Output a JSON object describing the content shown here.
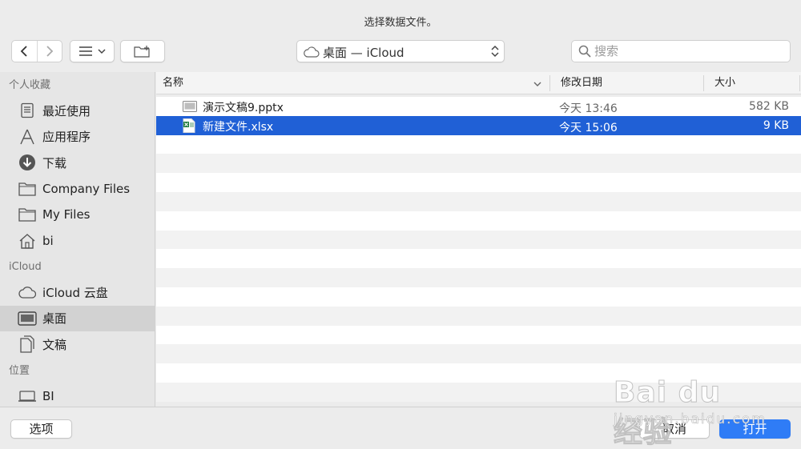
{
  "window": {
    "title": "选择数据文件。"
  },
  "toolbar": {
    "location": "桌面 — iCloud",
    "search_placeholder": "搜索"
  },
  "sidebar": {
    "sections": [
      {
        "title": "个人收藏",
        "items": [
          {
            "label": "最近使用",
            "icon": "recents-icon"
          },
          {
            "label": "应用程序",
            "icon": "applications-icon"
          },
          {
            "label": "下载",
            "icon": "downloads-icon"
          },
          {
            "label": "Company Files",
            "icon": "folder-icon"
          },
          {
            "label": "My Files",
            "icon": "folder-icon"
          },
          {
            "label": "bi",
            "icon": "home-icon"
          }
        ]
      },
      {
        "title": "iCloud",
        "items": [
          {
            "label": "iCloud 云盘",
            "icon": "cloud-icon"
          },
          {
            "label": "桌面",
            "icon": "desktop-icon",
            "active": true
          },
          {
            "label": "文稿",
            "icon": "documents-icon"
          }
        ]
      },
      {
        "title": "位置",
        "items": [
          {
            "label": "BI",
            "icon": "laptop-icon"
          }
        ]
      }
    ]
  },
  "columns": {
    "name": "名称",
    "modified": "修改日期",
    "size": "大小"
  },
  "files": [
    {
      "name": "演示文稿9.pptx",
      "modified": "今天 13:46",
      "size": "582 KB",
      "icon": "pptx-file-icon",
      "selected": false
    },
    {
      "name": "新建文件.xlsx",
      "modified": "今天 15:06",
      "size": "9 KB",
      "icon": "xlsx-file-icon",
      "selected": true
    }
  ],
  "buttons": {
    "options": "选项",
    "cancel": "取消",
    "open": "打开"
  },
  "watermark": {
    "brand": "Bai du 经验",
    "url": "jingyan.baidu.com"
  }
}
